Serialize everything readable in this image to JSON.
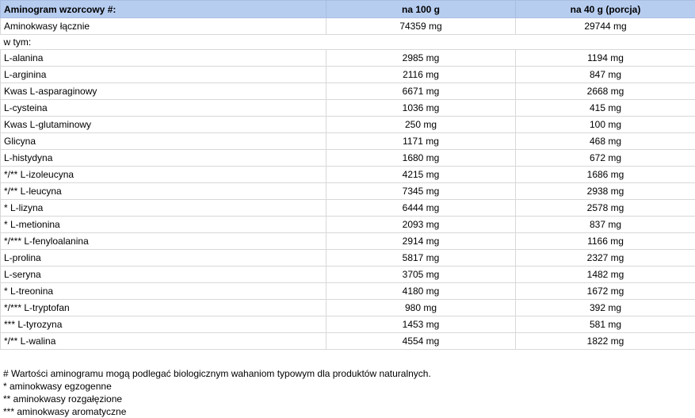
{
  "header": {
    "col1": "Aminogram wzorcowy #:",
    "col2": "na 100 g",
    "col3": "na 40 g (porcja)"
  },
  "total": {
    "label": "Aminokwasy łącznie",
    "per100": "74359 mg",
    "per40": "29744 mg"
  },
  "subheading": "w tym:",
  "rows": [
    {
      "label": "L-alanina",
      "per100": "2985 mg",
      "per40": "1194 mg"
    },
    {
      "label": "L-arginina",
      "per100": "2116 mg",
      "per40": "847 mg"
    },
    {
      "label": "Kwas L-asparaginowy",
      "per100": "6671 mg",
      "per40": "2668 mg"
    },
    {
      "label": "L-cysteina",
      "per100": "1036 mg",
      "per40": "415 mg"
    },
    {
      "label": "Kwas L-glutaminowy",
      "per100": "250 mg",
      "per40": "100 mg"
    },
    {
      "label": "Glicyna",
      "per100": "1171 mg",
      "per40": "468 mg"
    },
    {
      "label": "L-histydyna",
      "per100": "1680 mg",
      "per40": "672 mg"
    },
    {
      "label": "*/** L-izoleucyna",
      "per100": "4215 mg",
      "per40": "1686 mg"
    },
    {
      "label": "*/** L-leucyna",
      "per100": "7345 mg",
      "per40": "2938 mg"
    },
    {
      "label": "* L-lizyna",
      "per100": "6444 mg",
      "per40": "2578 mg"
    },
    {
      "label": "* L-metionina",
      "per100": "2093 mg",
      "per40": "837 mg"
    },
    {
      "label": "*/*** L-fenyloalanina",
      "per100": "2914 mg",
      "per40": "1166 mg"
    },
    {
      "label": "L-prolina",
      "per100": "5817 mg",
      "per40": "2327 mg"
    },
    {
      "label": "L-seryna",
      "per100": "3705 mg",
      "per40": "1482 mg"
    },
    {
      "label": "* L-treonina",
      "per100": "4180 mg",
      "per40": "1672 mg"
    },
    {
      "label": "*/*** L-tryptofan",
      "per100": "980 mg",
      "per40": "392 mg"
    },
    {
      "label": "*** L-tyrozyna",
      "per100": "1453 mg",
      "per40": "581 mg"
    },
    {
      "label": "*/** L-walina",
      "per100": "4554 mg",
      "per40": "1822 mg"
    }
  ],
  "notes": [
    "# Wartości aminogramu mogą podlegać biologicznym wahaniom typowym dla produktów naturalnych.",
    "* aminokwasy egzogenne",
    "** aminokwasy rozgałęzione",
    "*** aminokwasy aromatyczne"
  ]
}
